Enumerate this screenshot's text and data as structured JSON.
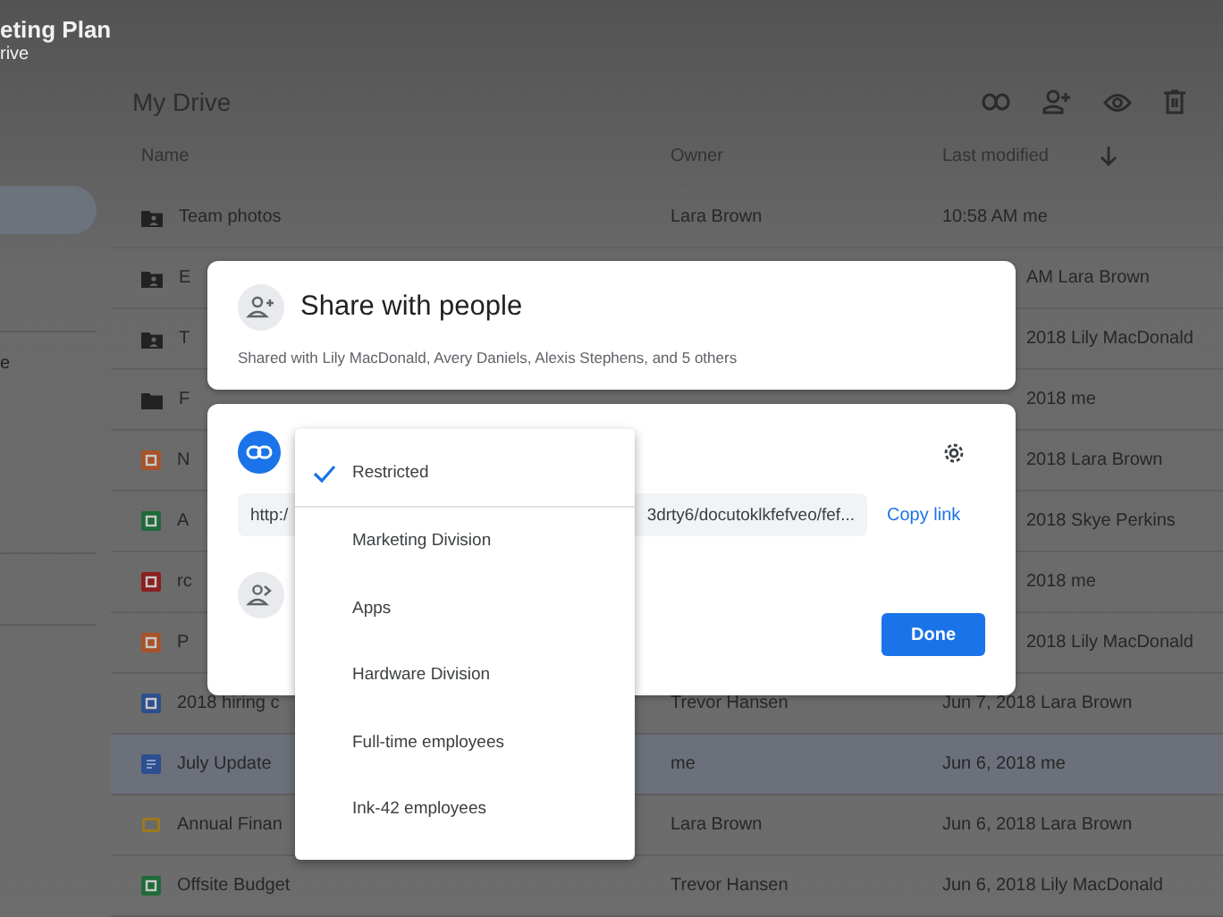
{
  "app": {
    "title": "eting Plan",
    "subtitle": "rive"
  },
  "sidebar": {
    "items": [
      {
        "selected": true
      },
      {
        "label": "e",
        "selected": false
      }
    ]
  },
  "header": {
    "title": "My Drive"
  },
  "table": {
    "columns": [
      "Name",
      "Owner",
      "Last modified"
    ],
    "rows": [
      {
        "kind": "shared-folder",
        "name": "Team photos",
        "owner": "Lara Brown",
        "modified": "10:58 AM me",
        "selected": false
      },
      {
        "kind": "shared-folder",
        "name": "E",
        "modified": "AM Lara Brown",
        "selected": false
      },
      {
        "kind": "shared-folder",
        "name": "T",
        "modified": "2018 Lily MacDonald",
        "selected": false
      },
      {
        "kind": "folder",
        "name": "F",
        "modified": "2018 me",
        "selected": false
      },
      {
        "kind": "slides",
        "name": "N",
        "modified": "2018 Lara Brown",
        "selected": false
      },
      {
        "kind": "sheet",
        "name": "A",
        "modified": "2018 Skye Perkins",
        "selected": false
      },
      {
        "kind": "pdf",
        "name": "rc",
        "modified": "2018 me",
        "selected": false
      },
      {
        "kind": "slides",
        "name": "P",
        "modified": "2018 Lily MacDonald",
        "selected": false
      },
      {
        "kind": "doc",
        "name": "2018 hiring c",
        "owner": "Trevor Hansen",
        "modified": "Jun 7, 2018 Lara Brown",
        "selected": false
      },
      {
        "kind": "doc-lines",
        "name": "July Update",
        "owner": "me",
        "modified": "Jun 6, 2018 me",
        "selected": true
      },
      {
        "kind": "slides-yellow",
        "name": "Annual Finan",
        "owner": "Lara Brown",
        "modified": "Jun 6, 2018 Lara Brown",
        "selected": false
      },
      {
        "kind": "sheet",
        "name": "Offsite Budget",
        "owner": "Trevor Hansen",
        "modified": "Jun 6, 2018 Lily MacDonald",
        "selected": false
      }
    ]
  },
  "share_dialog": {
    "title": "Share with people",
    "shared_with": "Shared with Lily MacDonald, Avery Daniels, Alexis Stephens, and 5 others"
  },
  "link_dialog": {
    "url_start": "http:/",
    "url_end": "3drty6/docutoklkfefveo/fef...",
    "copy_link": "Copy link",
    "done": "Done"
  },
  "access_menu": {
    "items": [
      {
        "label": "Restricted",
        "selected": true
      },
      {
        "label": "Marketing Division",
        "selected": false
      },
      {
        "label": "Apps",
        "selected": false
      },
      {
        "label": "Hardware Division",
        "selected": false
      },
      {
        "label": "Full-time employees",
        "selected": false
      },
      {
        "label": "Ink-42 employees",
        "selected": false
      }
    ]
  }
}
